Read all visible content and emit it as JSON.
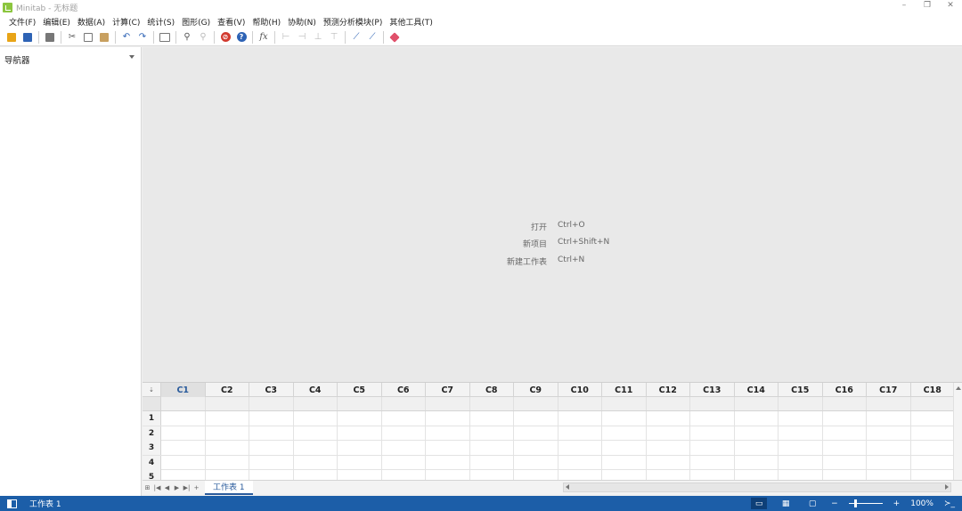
{
  "window": {
    "title": "Minitab - 无标题",
    "controls": [
      "–",
      "❐",
      "✕"
    ]
  },
  "menu": [
    "文件(F)",
    "编辑(E)",
    "数据(A)",
    "计算(C)",
    "统计(S)",
    "图形(G)",
    "查看(V)",
    "帮助(H)",
    "协助(N)",
    "预测分析模块(P)",
    "其他工具(T)"
  ],
  "toolbar_icons": [
    "open-icon",
    "save-icon",
    "print-icon",
    "cut-icon",
    "copy-icon",
    "paste-icon",
    "undo-icon",
    "redo-icon",
    "window-icon",
    "find-icon",
    "replace-icon",
    "cancel-icon",
    "help-icon",
    "function-icon",
    "insert-col-icon",
    "insert-row-icon",
    "delete-icon",
    "move-icon",
    "graph-edit-icon",
    "graph-brush-icon",
    "eraser-icon"
  ],
  "navigator": {
    "title": "导航器"
  },
  "shortcuts": [
    {
      "label": "打开",
      "key": "Ctrl+O"
    },
    {
      "label": "新项目",
      "key": "Ctrl+Shift+N"
    },
    {
      "label": "新建工作表",
      "key": "Ctrl+N"
    }
  ],
  "worksheet": {
    "corner_symbol": "⇣",
    "columns": [
      "C1",
      "C2",
      "C3",
      "C4",
      "C5",
      "C6",
      "C7",
      "C8",
      "C9",
      "C10",
      "C11",
      "C12",
      "C13",
      "C14",
      "C15",
      "C16",
      "C17",
      "C18"
    ],
    "active_column": "C1",
    "rows": [
      "1",
      "2",
      "3",
      "4",
      "5"
    ]
  },
  "tabs": {
    "nav": [
      "⊞",
      "|◀",
      "◀",
      "▶",
      "▶|",
      "+"
    ],
    "sheet_label": "工作表 1"
  },
  "status": {
    "text": "工作表 1",
    "zoom": "100%",
    "minus": "−",
    "plus": "+",
    "cmd": "≻_"
  },
  "colors": {
    "status_bar": "#1c5ea8",
    "accent": "#2a5b9c",
    "output_bg": "#e9e9e9"
  }
}
